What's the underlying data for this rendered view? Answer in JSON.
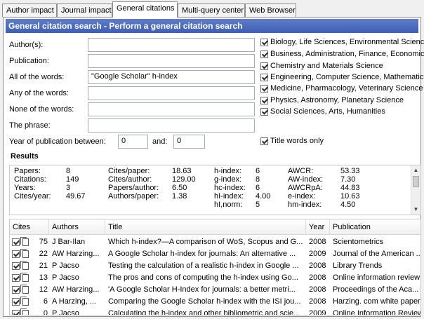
{
  "tabs": [
    "Author impact",
    "Journal impact",
    "General citations",
    "Multi-query center",
    "Web Browser"
  ],
  "active_tab": "General citations",
  "header": {
    "title": "General citation search - Perform a general citation search"
  },
  "form": {
    "authors_label": "Author(s):",
    "authors_value": "",
    "publication_label": "Publication:",
    "publication_value": "",
    "all_words_label": "All of the words:",
    "all_words_value": "\"Google Scholar\" h-index",
    "any_words_label": "Any of the words:",
    "any_words_value": "",
    "none_words_label": "None of the words:",
    "none_words_value": "",
    "phrase_label": "The phrase:",
    "phrase_value": "",
    "year_label": "Year of publication between:",
    "year_from": "0",
    "and_label": "and:",
    "year_to": "0",
    "title_words_only": "Title words only"
  },
  "subject_areas": [
    "Biology, Life Sciences, Environmental Science",
    "Business, Administration, Finance, Economics",
    "Chemistry and Materials Science",
    "Engineering, Computer Science, Mathematics",
    "Medicine, Pharmacology, Veterinary Science",
    "Physics, Astronomy, Planetary Science",
    "Social Sciences, Arts, Humanities"
  ],
  "results": {
    "title": "Results",
    "col1": [
      [
        "Papers:",
        "8"
      ],
      [
        "Citations:",
        "149"
      ],
      [
        "Years:",
        "3"
      ],
      [
        "Cites/year:",
        "49.67"
      ]
    ],
    "col2": [
      [
        "Cites/paper:",
        "18.63"
      ],
      [
        "Cites/author:",
        "129.00"
      ],
      [
        "Papers/author:",
        "6.50"
      ],
      [
        "Authors/paper:",
        "1.38"
      ]
    ],
    "col3": [
      [
        "h-index:",
        "6"
      ],
      [
        "g-index:",
        "8"
      ],
      [
        "hc-index:",
        "6"
      ],
      [
        "hI-index:",
        "4.00"
      ],
      [
        "hI,norm:",
        "5"
      ]
    ],
    "col4": [
      [
        "AWCR:",
        "53.33"
      ],
      [
        "AW-index:",
        "7.30"
      ],
      [
        "AWCRpA:",
        "44.83"
      ],
      [
        "e-index:",
        "10.63"
      ],
      [
        "hm-index:",
        "4.50"
      ]
    ]
  },
  "table": {
    "columns": [
      "Cites",
      "Authors",
      "Title",
      "Year",
      "Publication"
    ],
    "rows": [
      {
        "cites": "75",
        "authors": "J Bar-Ilan",
        "title": "Which h-index?—A comparison of WoS, Scopus and G...",
        "year": "2008",
        "publication": "Scientometrics"
      },
      {
        "cites": "22",
        "authors": "AW Harzing...",
        "title": "A Google Scholar h-index for journals: An alternative ...",
        "year": "2009",
        "publication": "Journal of the American ..."
      },
      {
        "cites": "21",
        "authors": "P Jacso",
        "title": "Testing the calculation of a realistic h-index in Google ...",
        "year": "2008",
        "publication": "Library Trends"
      },
      {
        "cites": "13",
        "authors": "P Jacso",
        "title": "The pros and cons of computing the h-index using Go...",
        "year": "2008",
        "publication": "Online information review"
      },
      {
        "cites": "12",
        "authors": "AW Harzing...",
        "title": "'A Google Scholar H-Index for journals: a better metri...",
        "year": "2008",
        "publication": "Proceedings of the Aca..."
      },
      {
        "cites": "6",
        "authors": "A Harzing, ...",
        "title": "Comparing the Google Scholar h-index with the ISI jou...",
        "year": "2008",
        "publication": "Harzing. com white paper"
      },
      {
        "cites": "0",
        "authors": "P Jacso",
        "title": "Calculating the h-index and other bibliometric and scie...",
        "year": "2009",
        "publication": "Online Information Review"
      }
    ]
  }
}
